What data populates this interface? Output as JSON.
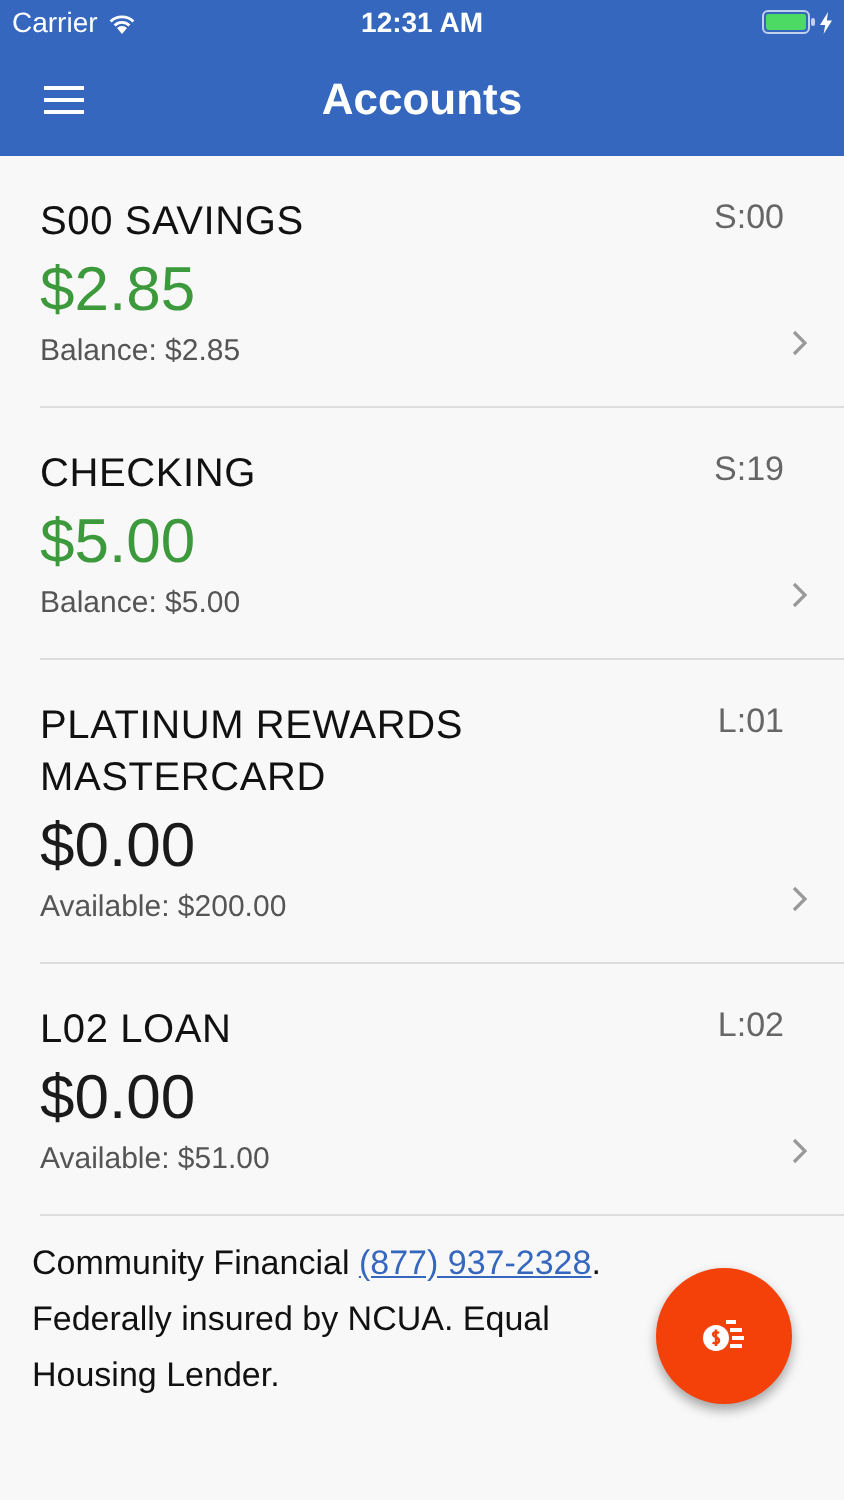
{
  "status_bar": {
    "carrier": "Carrier",
    "time": "12:31 AM"
  },
  "nav_bar": {
    "title": "Accounts"
  },
  "accounts": [
    {
      "name": "S00 SAVINGS",
      "code": "S:00",
      "amount": "$2.85",
      "color": "#3c9a3c",
      "detail": "Balance: $2.85"
    },
    {
      "name": "CHECKING",
      "code": "S:19",
      "amount": "$5.00",
      "color": "#3c9a3c",
      "detail": "Balance: $5.00"
    },
    {
      "name": "PLATINUM REWARDS MASTERCARD",
      "code": "L:01",
      "amount": "$0.00",
      "color": "#1a1a1a",
      "detail": "Available: $200.00"
    },
    {
      "name": "L02 LOAN",
      "code": "L:02",
      "amount": "$0.00",
      "color": "#1a1a1a",
      "detail": "Available: $51.00"
    }
  ],
  "footer": {
    "text_before": "Community Financial ",
    "phone": "(877) 937-2328",
    "text_after": ". Federally insured by NCUA. Equal Housing Lender."
  }
}
